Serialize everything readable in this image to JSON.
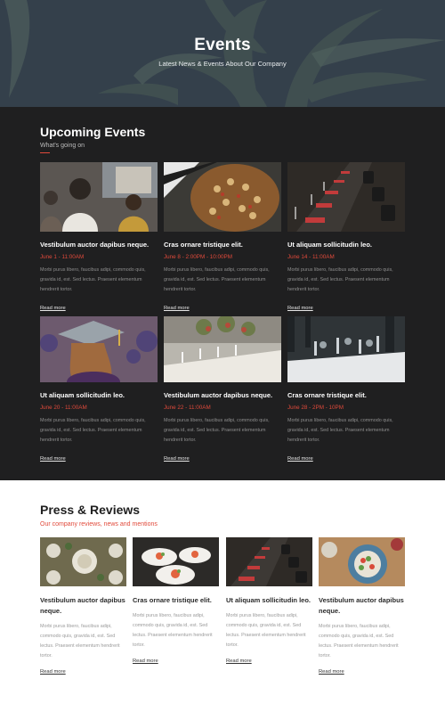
{
  "hero": {
    "title": "Events",
    "subtitle": "Latest News & Events About Our Company"
  },
  "upcoming": {
    "title": "Upcoming Events",
    "subtitle": "What's going on",
    "events": [
      {
        "title": "Vestibulum auctor dapibus neque.",
        "date": "June 1 - 11:00AM",
        "text": "Morbi purus libero, faucibus adipi, commodo quis, gravida id, est. Sed lectus. Praesent elementum hendrerit tortor.",
        "link": "Read more",
        "image": "concert-crowd-photo"
      },
      {
        "title": "Cras ornare tristique elit.",
        "date": "June 8 - 2:00PM - 10:00PM",
        "text": "Morbi purus libero, faucibus adipi, commodo quis, gravida id, est. Sed lectus. Praesent elementum hendrerit tortor.",
        "link": "Read more",
        "image": "food-platter-photo"
      },
      {
        "title": "Ut aliquam sollicitudin leo.",
        "date": "June 14 - 11:00AM",
        "text": "Morbi purus libero, faucibus adipi, commodo quis, gravida id, est. Sed lectus. Praesent elementum hendrerit tortor.",
        "link": "Read more",
        "image": "banquet-table-photo"
      },
      {
        "title": "Ut aliquam sollicitudin leo.",
        "date": "June 20 - 11:00AM",
        "text": "Morbi purus libero, faucibus adipi, commodo quis, gravida id, est. Sed lectus. Praesent elementum hendrerit tortor.",
        "link": "Read more",
        "image": "graduation-photo"
      },
      {
        "title": "Vestibulum auctor dapibus neque.",
        "date": "June 22 - 11:00AM",
        "text": "Morbi purus libero, faucibus adipi, commodo quis, gravida id, est. Sed lectus. Praesent elementum hendrerit tortor.",
        "link": "Read more",
        "image": "wedding-table-photo"
      },
      {
        "title": "Cras ornare tristique elit.",
        "date": "June 28 - 2PM - 10PM",
        "text": "Morbi purus libero, faucibus adipi, commodo quis, gravida id, est. Sed lectus. Praesent elementum hendrerit tortor.",
        "link": "Read more",
        "image": "dinner-hall-photo"
      }
    ]
  },
  "press": {
    "title": "Press & Reviews",
    "subtitle": "Our company reviews, news and mentions",
    "items": [
      {
        "title": "Vestibulum auctor dapibus neque.",
        "text": "Morbi purus libero, faucibus adipi, commodo quis, gravida id, est. Sed lectus. Praesent elementum hendrerit tortor.",
        "link": "Read more",
        "image": "table-setting-photo"
      },
      {
        "title": "Cras ornare tristique elit.",
        "text": "Morbi purus libero, faucibus adipi, commodo quis, gravida id, est. Sed lectus. Praesent elementum hendrerit tortor.",
        "link": "Read more",
        "image": "plated-dishes-photo"
      },
      {
        "title": "Ut aliquam sollicitudin leo.",
        "text": "Morbi purus libero, faucibus adipi, commodo quis, gravida id, est. Sed lectus. Praesent elementum hendrerit tortor.",
        "link": "Read more",
        "image": "banquet-table-photo"
      },
      {
        "title": "Vestibulum auctor dapibus neque.",
        "text": "Morbi purus libero, faucibus adipi, commodo quis, gravida id, est. Sed lectus. Praesent elementum hendrerit tortor.",
        "link": "Read more",
        "image": "salad-bowl-photo"
      }
    ]
  },
  "colors": {
    "accent": "#e14a3b",
    "dark_section": "#1f1f20",
    "hero_overlay": "#34404b"
  }
}
